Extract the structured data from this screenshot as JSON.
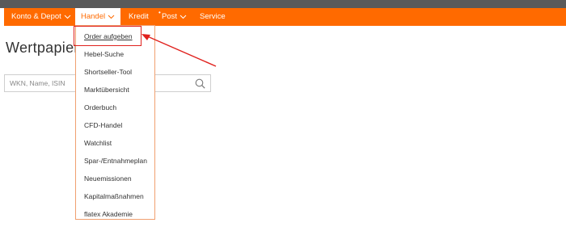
{
  "nav": {
    "items": [
      {
        "label": "Konto & Depot",
        "has_chevron": true
      },
      {
        "label": "Handel",
        "has_chevron": true,
        "active": true
      },
      {
        "label": "Kredit",
        "has_chevron": false
      },
      {
        "label": "Post",
        "has_chevron": true,
        "marker": "•"
      },
      {
        "label": "Service",
        "has_chevron": false
      }
    ]
  },
  "dropdown": {
    "items": [
      "Order aufgeben",
      "Hebel-Suche",
      "Shortseller-Tool",
      "Marktübersicht",
      "Orderbuch",
      "CFD-Handel",
      "Watchlist",
      "Spar-/Entnahmeplan",
      "Neuemissionen",
      "Kapitalmaßnahmen",
      "flatex Akademie"
    ]
  },
  "page": {
    "title": "Wertpapier"
  },
  "search": {
    "placeholder": "WKN, Name, ISIN",
    "value": ""
  },
  "icons": {
    "search": "search-icon",
    "chevron": "chevron-down-icon",
    "annotation_arrow": "arrow-icon"
  },
  "colors": {
    "nav_background": "#ff6a00",
    "top_strip": "#5a5a5a",
    "highlight": "#e0211d",
    "dropdown_border": "#f0a070"
  }
}
